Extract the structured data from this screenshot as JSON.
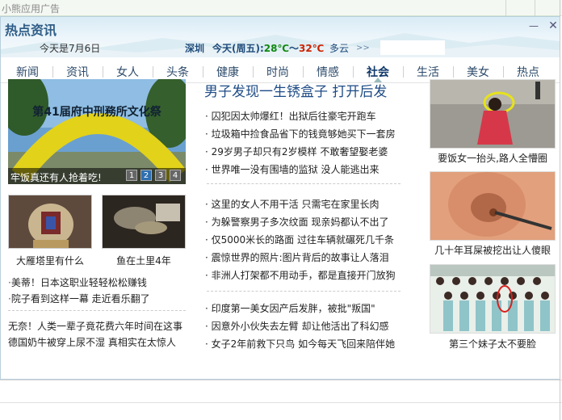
{
  "app": {
    "title": "小熊应用广告"
  },
  "window": {
    "title": "热点资讯",
    "minimize_symbol": "—",
    "close_symbol": "✕",
    "date_text": "今天是7月6日",
    "city": "深圳",
    "today_label": "今天(周五):",
    "temp_low": "28℃",
    "temp_sep": "～",
    "temp_high": "32℃",
    "weather": "多云",
    "more_symbol": ">>"
  },
  "nav": {
    "items": [
      "新闻",
      "资讯",
      "女人",
      "头条",
      "健康",
      "时尚",
      "情感",
      "社会",
      "生活",
      "美女",
      "热点"
    ],
    "active_index": 7
  },
  "featured": {
    "caption": "牢饭真还有人抢着吃!",
    "dots": [
      "1",
      "2",
      "3",
      "4"
    ],
    "active_dot": 1,
    "banner_text": "第41届府中刑務所文化祭"
  },
  "thumbs": [
    {
      "caption": "大雁塔里有什么"
    },
    {
      "caption": "鱼在土里4年"
    }
  ],
  "left_links": [
    {
      "bullet": "·",
      "text": "美蒂！日本这职业轻轻松松赚钱"
    },
    {
      "bullet": "·",
      "text": "院子看到这样一幕 走近看乐翻了"
    }
  ],
  "left_plain": [
    "无奈！人类一辈子竟花费六年时间在这事",
    "德国奶牛被穿上尿不湿 真相实在太惊人"
  ],
  "middle": {
    "headline": "男子发现一生锈盒子 打开后发",
    "group1": [
      "· 囚犯因太帅爆红！出狱后往豪宅开跑车",
      "· 垃圾箱中捡食品省下的钱竟够她买下一套房",
      "· 29岁男子却只有2岁模样 不敢奢望娶老婆",
      "· 世界唯一没有围墙的监狱 没人能逃出来"
    ],
    "group2": [
      "· 这里的女人不用干活 只需宅在家里长肉",
      "· 为躲警察男子多次纹面 现亲妈都认不出了",
      "· 仅5000米长的路面 过往车辆就碾死几千条",
      "· 震惊世界的照片:图片背后的故事让人落泪",
      "· 非洲人打架都不用动手，都是直接开门放狗"
    ],
    "group3": [
      "· 印度第一美女因产后发胖，被批\"叛国\"",
      "· 因意外小伙失去左臂 却让他活出了科幻感",
      "· 女子2年前救下只鸟 如今每天飞回来陪伴她"
    ]
  },
  "right": [
    {
      "caption": "要饭女一抬头,路人全懵圈"
    },
    {
      "caption": "几十年耳屎被挖出让人傻眼"
    },
    {
      "caption": "第三个妹子太不要脸"
    }
  ]
}
